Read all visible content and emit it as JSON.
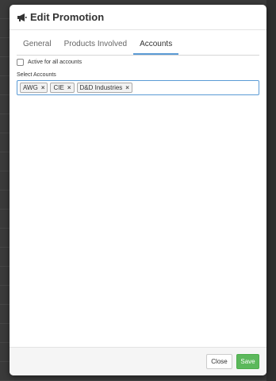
{
  "modal": {
    "title": "Edit Promotion",
    "icon": "megaphone-icon"
  },
  "tabs": [
    {
      "label": "General",
      "active": false
    },
    {
      "label": "Products Involved",
      "active": false
    },
    {
      "label": "Accounts",
      "active": true
    }
  ],
  "accounts": {
    "active_all_label": "Active for all accounts",
    "active_all_checked": false,
    "select_label": "Select Accounts",
    "selected": [
      {
        "label": "AWG"
      },
      {
        "label": "CIE"
      },
      {
        "label": "D&D Industries"
      }
    ],
    "remove_glyph": "×"
  },
  "footer": {
    "close_label": "Close",
    "save_label": "Save"
  },
  "colors": {
    "accent": "#5b9bd5",
    "save": "#5cb85c"
  }
}
